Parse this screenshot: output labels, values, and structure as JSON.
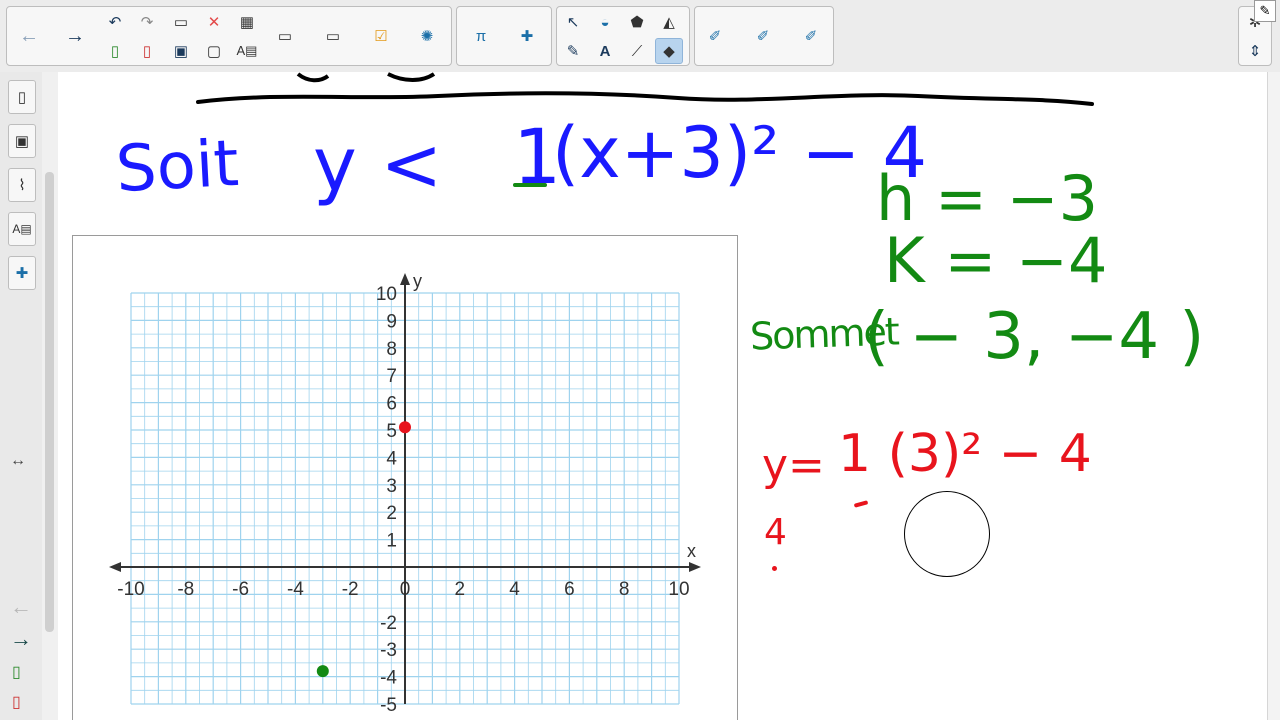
{
  "toolbar": {
    "icons": [
      "back-arrow",
      "forward-arrow",
      "undo",
      "redo",
      "paste",
      "delete",
      "table",
      "new-page",
      "delete-page",
      "save",
      "screen-shade",
      "properties",
      "screen-capture",
      "camera",
      "check-survey",
      "addon-robot",
      "math-pi",
      "addon-puzzle",
      "select-arrow",
      "shapes",
      "fill-shape",
      "paint-bucket",
      "pens",
      "text",
      "line",
      "eraser",
      "magic-pen-1",
      "magic-pen-2",
      "magic-pen-3"
    ]
  },
  "sidebar": {
    "items": [
      "page-sorter",
      "gallery",
      "attachments",
      "properties",
      "addons"
    ],
    "nav_back_label": "←",
    "nav_forward_label": "→"
  },
  "ink": {
    "soit": "Soit",
    "inequality": "y <",
    "coeff": "1",
    "expression": "(x+3)² − 4",
    "h_line": "h = −3",
    "k_line": "K = −4",
    "sommet_word": "Sommet",
    "sommet_value": "( − 3, −4 )",
    "red_eq_y": "y=",
    "red_eq_rest": "1 (3)² − 4",
    "red_four": "4",
    "colors": {
      "blue": "#1a1aff",
      "green": "#138a13",
      "red": "#e8141d",
      "black": "#000000"
    }
  },
  "chart_data": {
    "type": "scatter",
    "title": "",
    "xlabel": "x",
    "ylabel": "y",
    "xlim": [
      -10,
      10
    ],
    "ylim": [
      -5,
      10
    ],
    "x_ticks": [
      -10,
      -8,
      -6,
      -4,
      -2,
      0,
      2,
      4,
      6,
      8,
      10
    ],
    "y_ticks": [
      10,
      9,
      8,
      7,
      6,
      5,
      4,
      3,
      2,
      1,
      -2,
      -3,
      -4,
      -5
    ],
    "grid": true,
    "points": [
      {
        "x": 0,
        "y": 5.1,
        "color": "#e8141d"
      },
      {
        "x": -3,
        "y": -3.8,
        "color": "#138a13"
      }
    ]
  }
}
